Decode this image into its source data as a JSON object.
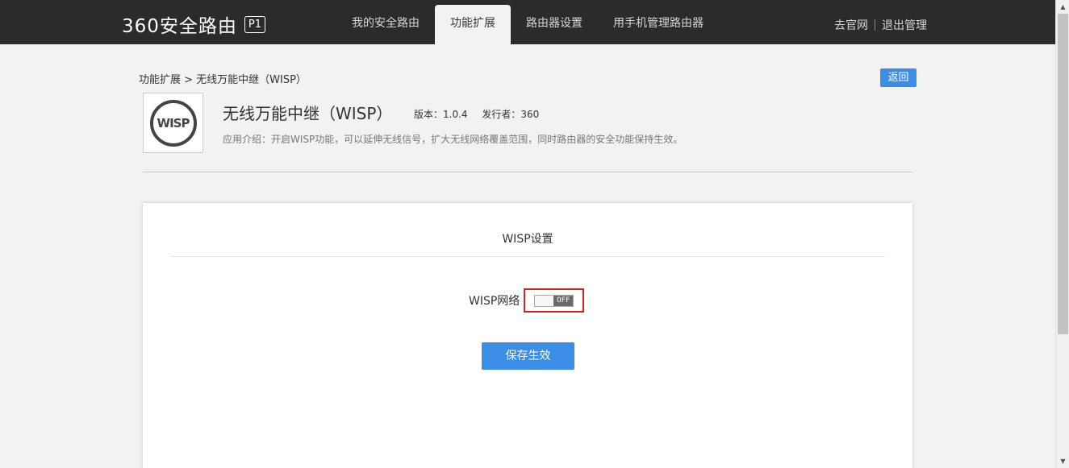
{
  "header": {
    "logo_text": "360安全路由",
    "logo_model": "P1",
    "nav": [
      {
        "label": "我的安全路由",
        "active": false
      },
      {
        "label": "功能扩展",
        "active": true
      },
      {
        "label": "路由器设置",
        "active": false
      },
      {
        "label": "用手机管理路由器",
        "active": false
      }
    ],
    "links": {
      "official_site": "去官网",
      "logout": "退出管理"
    }
  },
  "breadcrumb": "功能扩展 > 无线万能中继（WISP）",
  "back_label": "返回",
  "app": {
    "icon_text": "WISP",
    "title": "无线万能中继（WISP）",
    "version": "版本：1.0.4",
    "publisher": "发行者：360",
    "description": "应用介绍：开启WISP功能，可以延伸无线信号，扩大无线网络覆盖范围，同时路由器的安全功能保持生效。"
  },
  "panel": {
    "title": "WISP设置",
    "toggle_label": "WISP网络",
    "toggle_state": "OFF",
    "save_label": "保存生效"
  },
  "colors": {
    "topbar": "#2b2b2b",
    "accent": "#3c8de6",
    "highlight": "#d2231d"
  }
}
